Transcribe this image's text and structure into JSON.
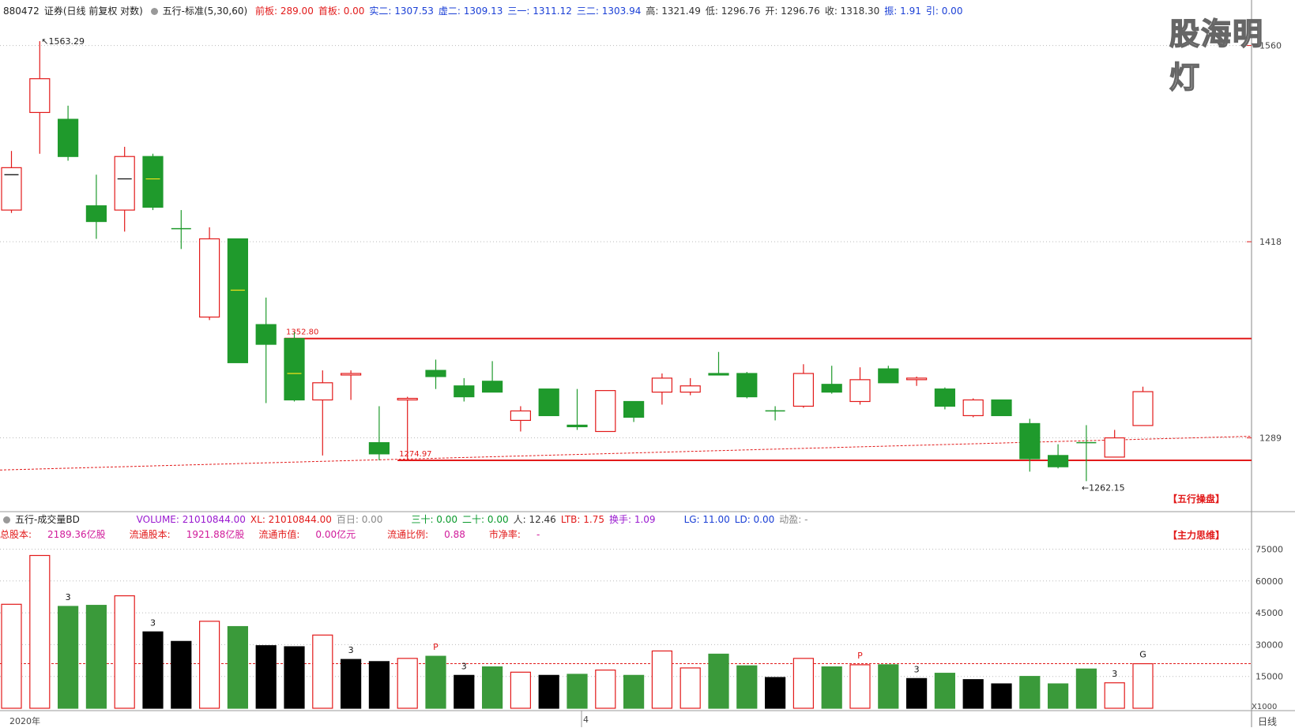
{
  "header_top": {
    "code": "880472",
    "name": "证券",
    "mode": "(日线 前复权 对数)",
    "indicator": "五行-标准(5,30,60)",
    "fields": [
      {
        "label": "前板:",
        "value": "289.00",
        "color": "red"
      },
      {
        "label": "首板:",
        "value": "0.00",
        "color": "red"
      },
      {
        "label": "实二:",
        "value": "1307.53",
        "color": "blue"
      },
      {
        "label": "虚二:",
        "value": "1309.13",
        "color": "blue"
      },
      {
        "label": "三一:",
        "value": "1311.12",
        "color": "blue"
      },
      {
        "label": "三二:",
        "value": "1303.94",
        "color": "blue"
      },
      {
        "label": "高:",
        "value": "1321.49",
        "color": "dark"
      },
      {
        "label": "低:",
        "value": "1296.76",
        "color": "dark"
      },
      {
        "label": "开:",
        "value": "1296.76",
        "color": "dark"
      },
      {
        "label": "收:",
        "value": "1318.30",
        "color": "dark"
      },
      {
        "label": "振:",
        "value": "1.91",
        "color": "blue"
      },
      {
        "label": "引:",
        "value": "0.00",
        "color": "blue"
      }
    ]
  },
  "watermark": "股海明灯",
  "tags": {
    "wuxing": "【五行操盘】",
    "zhuli": "【主力思维】"
  },
  "volume_header": {
    "title": "五行-成交量BD",
    "fields": [
      {
        "label": "VOLUME:",
        "value": "21010844.00",
        "color": "purple"
      },
      {
        "label": "XL:",
        "value": "21010844.00",
        "color": "red"
      },
      {
        "label": "百日:",
        "value": "0.00",
        "color": "gray"
      },
      {
        "label": "三十:",
        "value": "0.00",
        "color": "green"
      },
      {
        "label": "二十:",
        "value": "0.00",
        "color": "green"
      },
      {
        "label": "人:",
        "value": "12.46",
        "color": "dark"
      },
      {
        "label": "LTB:",
        "value": "1.75",
        "color": "red"
      },
      {
        "label": "换手:",
        "value": "1.09",
        "color": "purple"
      },
      {
        "label": "LG:",
        "value": "11.00",
        "color": "blue"
      },
      {
        "label": "LD:",
        "value": "0.00",
        "color": "blue"
      },
      {
        "label": "动盈:",
        "value": "-",
        "color": "gray"
      }
    ],
    "stats": [
      {
        "label": "总股本:",
        "value": "2189.36亿股"
      },
      {
        "label": "流通股本:",
        "value": "1921.88亿股"
      },
      {
        "label": "流通市值:",
        "value": "0.00亿元"
      },
      {
        "label": "流通比例:",
        "value": "0.88"
      },
      {
        "label": "市净率:",
        "value": "-"
      }
    ]
  },
  "footer": {
    "year": "2020年",
    "month": "4",
    "period": "日线",
    "vol_unit": "X1000"
  },
  "chart_data": [
    {
      "type": "candlestick",
      "scale": "log",
      "ylim": [
        1245,
        1590
      ],
      "y_ticks": [
        1289,
        1418,
        1560
      ],
      "annotations": {
        "high_label": "1563.29",
        "low_label": "1262.15",
        "box_top_label": "1352.80",
        "box_bottom_label": "1274.97"
      },
      "levels": {
        "box_top": 1352.8,
        "box_bottom": 1274.97
      },
      "candles": [
        {
          "o": 1470,
          "h": 1482,
          "l": 1438,
          "c": 1440,
          "dir": "up",
          "mid": 1465
        },
        {
          "o": 1510,
          "h": 1563.29,
          "l": 1480,
          "c": 1535,
          "dir": "up"
        },
        {
          "o": 1505,
          "h": 1515,
          "l": 1475,
          "c": 1478,
          "dir": "down"
        },
        {
          "o": 1443,
          "h": 1465,
          "l": 1420,
          "c": 1432,
          "dir": "down"
        },
        {
          "o": 1440,
          "h": 1485,
          "l": 1425,
          "c": 1478,
          "dir": "up",
          "mid": 1462
        },
        {
          "o": 1478,
          "h": 1480,
          "l": 1440,
          "c": 1442,
          "dir": "down",
          "mid": 1462
        },
        {
          "o": 1427,
          "h": 1440,
          "l": 1413,
          "c": 1427,
          "dir": "doji"
        },
        {
          "o": 1367,
          "h": 1428,
          "l": 1365,
          "c": 1420,
          "dir": "up"
        },
        {
          "o": 1420,
          "h": 1420,
          "l": 1337,
          "c": 1337,
          "dir": "down",
          "mid": 1385
        },
        {
          "o": 1362,
          "h": 1380,
          "l": 1311,
          "c": 1349,
          "dir": "down"
        },
        {
          "o": 1352.8,
          "h": 1357,
          "l": 1312,
          "c": 1313,
          "dir": "down",
          "mid": 1330
        },
        {
          "o": 1313,
          "h": 1332,
          "l": 1278,
          "c": 1324,
          "dir": "up"
        },
        {
          "o": 1330,
          "h": 1332,
          "l": 1313,
          "c": 1329,
          "dir": "up"
        },
        {
          "o": 1286,
          "h": 1309,
          "l": 1275,
          "c": 1279,
          "dir": "down"
        },
        {
          "o": 1314,
          "h": 1315,
          "l": 1274.97,
          "c": 1313,
          "dir": "up"
        },
        {
          "o": 1332,
          "h": 1339,
          "l": 1320,
          "c": 1328,
          "dir": "down"
        },
        {
          "o": 1322,
          "h": 1327,
          "l": 1312,
          "c": 1315,
          "dir": "down"
        },
        {
          "o": 1325,
          "h": 1338,
          "l": 1318,
          "c": 1318,
          "dir": "down"
        },
        {
          "o": 1300,
          "h": 1309,
          "l": 1293,
          "c": 1306,
          "dir": "up"
        },
        {
          "o": 1320,
          "h": 1320,
          "l": 1303,
          "c": 1303,
          "dir": "down"
        },
        {
          "o": 1297,
          "h": 1320,
          "l": 1294,
          "c": 1296,
          "dir": "down"
        },
        {
          "o": 1293,
          "h": 1319,
          "l": 1293,
          "c": 1319,
          "dir": "up"
        },
        {
          "o": 1312,
          "h": 1312,
          "l": 1299,
          "c": 1302,
          "dir": "down"
        },
        {
          "o": 1318,
          "h": 1330,
          "l": 1310,
          "c": 1327,
          "dir": "up"
        },
        {
          "o": 1318,
          "h": 1327,
          "l": 1316,
          "c": 1322,
          "dir": "up"
        },
        {
          "o": 1330,
          "h": 1344,
          "l": 1329,
          "c": 1329,
          "dir": "down"
        },
        {
          "o": 1330,
          "h": 1331,
          "l": 1314,
          "c": 1315,
          "dir": "down"
        },
        {
          "o": 1306,
          "h": 1309,
          "l": 1300,
          "c": 1306,
          "dir": "doji"
        },
        {
          "o": 1309,
          "h": 1336,
          "l": 1308,
          "c": 1330,
          "dir": "up"
        },
        {
          "o": 1323,
          "h": 1335,
          "l": 1317,
          "c": 1318,
          "dir": "down"
        },
        {
          "o": 1312,
          "h": 1334,
          "l": 1310,
          "c": 1326,
          "dir": "up"
        },
        {
          "o": 1333,
          "h": 1335,
          "l": 1325,
          "c": 1324,
          "dir": "down"
        },
        {
          "o": 1327,
          "h": 1328,
          "l": 1322,
          "c": 1326,
          "dir": "up"
        },
        {
          "o": 1320,
          "h": 1321,
          "l": 1307,
          "c": 1309,
          "dir": "down"
        },
        {
          "o": 1303,
          "h": 1314,
          "l": 1302,
          "c": 1313,
          "dir": "up"
        },
        {
          "o": 1313,
          "h": 1313,
          "l": 1303,
          "c": 1303,
          "dir": "down"
        },
        {
          "o": 1298,
          "h": 1301,
          "l": 1268,
          "c": 1276,
          "dir": "down"
        },
        {
          "o": 1278,
          "h": 1285,
          "l": 1270,
          "c": 1271,
          "dir": "down"
        },
        {
          "o": 1285,
          "h": 1297,
          "l": 1262.15,
          "c": 1286,
          "dir": "doji"
        },
        {
          "o": 1277,
          "h": 1294,
          "l": 1277,
          "c": 1289,
          "dir": "up"
        },
        {
          "o": 1296.76,
          "h": 1321.49,
          "l": 1296.76,
          "c": 1318.3,
          "dir": "up"
        }
      ],
      "ma_line": {
        "start": 1269,
        "end": 1290
      }
    },
    {
      "type": "bar",
      "ylim": [
        0,
        80000
      ],
      "y_ticks": [
        15000,
        30000,
        45000,
        60000,
        75000
      ],
      "avg_line": 21010,
      "bars": [
        {
          "v": 49000,
          "style": "up"
        },
        {
          "v": 72000,
          "style": "up"
        },
        {
          "v": 48000,
          "style": "down",
          "mark": "3"
        },
        {
          "v": 48500,
          "style": "down"
        },
        {
          "v": 53000,
          "style": "up"
        },
        {
          "v": 36000,
          "style": "black",
          "mark": "3"
        },
        {
          "v": 31500,
          "style": "black"
        },
        {
          "v": 41000,
          "style": "up"
        },
        {
          "v": 38500,
          "style": "down"
        },
        {
          "v": 29500,
          "style": "black"
        },
        {
          "v": 29000,
          "style": "black"
        },
        {
          "v": 34500,
          "style": "up"
        },
        {
          "v": 23000,
          "style": "black",
          "mark": "3"
        },
        {
          "v": 22000,
          "style": "black"
        },
        {
          "v": 23500,
          "style": "up"
        },
        {
          "v": 24500,
          "style": "down",
          "mark": "P"
        },
        {
          "v": 15500,
          "style": "black",
          "mark": "3"
        },
        {
          "v": 19500,
          "style": "down"
        },
        {
          "v": 17000,
          "style": "up"
        },
        {
          "v": 15500,
          "style": "black"
        },
        {
          "v": 16000,
          "style": "down"
        },
        {
          "v": 18000,
          "style": "up"
        },
        {
          "v": 15500,
          "style": "down"
        },
        {
          "v": 27000,
          "style": "up"
        },
        {
          "v": 19000,
          "style": "up"
        },
        {
          "v": 25500,
          "style": "down"
        },
        {
          "v": 20000,
          "style": "down"
        },
        {
          "v": 14500,
          "style": "black"
        },
        {
          "v": 23500,
          "style": "up"
        },
        {
          "v": 19500,
          "style": "down"
        },
        {
          "v": 20500,
          "style": "up",
          "mark": "P"
        },
        {
          "v": 20500,
          "style": "down"
        },
        {
          "v": 14000,
          "style": "black",
          "mark": "3"
        },
        {
          "v": 16500,
          "style": "down"
        },
        {
          "v": 13500,
          "style": "black"
        },
        {
          "v": 11500,
          "style": "black"
        },
        {
          "v": 15000,
          "style": "down"
        },
        {
          "v": 11500,
          "style": "down"
        },
        {
          "v": 18500,
          "style": "down"
        },
        {
          "v": 12000,
          "style": "up",
          "mark": "3"
        },
        {
          "v": 21000,
          "style": "up",
          "mark": "G"
        }
      ]
    }
  ]
}
